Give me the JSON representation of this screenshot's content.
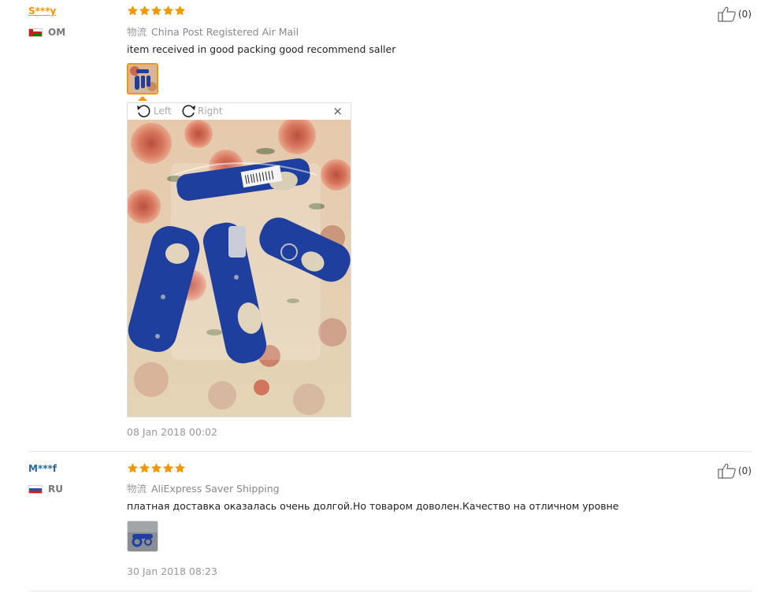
{
  "reviews": [
    {
      "user": "S***y",
      "country": "OM",
      "rating": 5,
      "shipping_label": "物流",
      "shipping": "China Post Registered Air Mail",
      "text": "item received in good packing good recommend saller",
      "helpful": "(0)",
      "date": "08 Jan 2018 00:02",
      "viewer": {
        "rotate_left": "Left",
        "rotate_right": "Right",
        "close": "×"
      }
    },
    {
      "user": "M***f",
      "country": "RU",
      "rating": 5,
      "shipping_label": "物流",
      "shipping": "AliExpress Saver Shipping",
      "text": "платная доставка оказалась очень долгой.Но товаром доволен.Качество на отличном уровне",
      "helpful": "(0)",
      "date": "30 Jan 2018 08:23"
    }
  ],
  "colors": {
    "accent": "#f39800",
    "link_blue": "#2469a6",
    "product_blue": "#1f3f9e"
  },
  "icons": [
    "star-icon",
    "thumbs-up-icon",
    "rotate-left-icon",
    "rotate-right-icon",
    "close-icon",
    "flag-om-icon",
    "flag-ru-icon"
  ]
}
